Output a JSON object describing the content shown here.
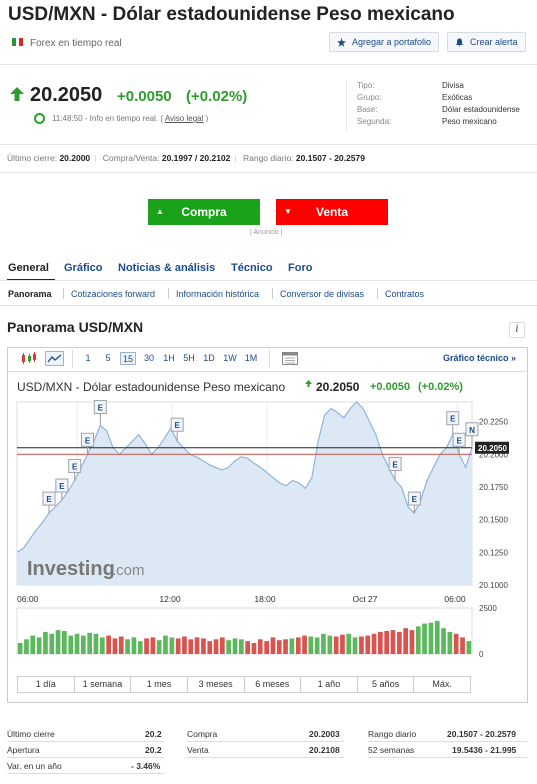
{
  "title": "USD/MXN - Dólar estadounidense Peso mexicano",
  "subtitle": "Forex en tiempo real",
  "buttons": {
    "portfolio": "Agregar a portafolio",
    "alert": "Crear alerta"
  },
  "price": {
    "last": "20.2050",
    "change": "+0.0050",
    "change_pct": "(+0.02%)"
  },
  "realtime": {
    "time": "11:48:50",
    "info": "- Info en tiempo real. (",
    "disclaimer": "Aviso legal",
    "close": ")"
  },
  "details": [
    {
      "label": "Tipo:",
      "value": "Divisa"
    },
    {
      "label": "Grupo:",
      "value": "Exóticas"
    },
    {
      "label": "Base:",
      "value": "Dólar estadounidense"
    },
    {
      "label": "Segunda:",
      "value": "Peso mexicano"
    }
  ],
  "stats": {
    "prev_close_label": "Último cierre:",
    "prev_close": "20.2000",
    "bidask_label": "Compra/Venta:",
    "bidask": "20.1997 / 20.2102",
    "range_label": "Rango diario:",
    "range": "20.1507 - 20.2579"
  },
  "cta": {
    "buy": "Compra",
    "sell": "Venta",
    "ad": "| Anuncio |"
  },
  "tabs": [
    "General",
    "Gráfico",
    "Noticias & análisis",
    "Técnico",
    "Foro"
  ],
  "subnav": [
    "Panorama",
    "Cotizaciones forward",
    "Información histórica",
    "Conversor de divisas",
    "Contratos"
  ],
  "section_title": "Panorama USD/MXN",
  "chart_toolbar": {
    "intervals": [
      "1",
      "5",
      "15",
      "30",
      "1H",
      "5H",
      "1D",
      "1W",
      "1M"
    ],
    "selected": "15",
    "technical_link": "Gráfico técnico »"
  },
  "chart_header": {
    "name": "USD/MXN - Dólar estadounidense Peso mexicano",
    "price": "20.2050",
    "change": "+0.0050",
    "change_pct": "(+0.02%)"
  },
  "watermark": {
    "brand": "Investing",
    "suffix": ".com"
  },
  "chart_data": {
    "type": "area",
    "x_labels": [
      "06:00",
      "12:00",
      "18:00",
      "Oct 27",
      "06:00"
    ],
    "y_ticks": [
      "20.2250",
      "20.2000",
      "20.1750",
      "20.1500",
      "20.1250",
      "20.1000"
    ],
    "ylim": [
      20.1,
      20.24
    ],
    "current_price_label": "20.2050",
    "previous_close": 20.2,
    "values": [
      20.125,
      20.128,
      20.135,
      20.142,
      20.148,
      20.155,
      20.16,
      20.165,
      20.172,
      20.18,
      20.19,
      20.2,
      20.21,
      20.222,
      20.218,
      20.205,
      20.2,
      20.205,
      20.21,
      20.215,
      20.208,
      20.2,
      20.205,
      20.212,
      20.22,
      20.21,
      20.205,
      20.2,
      20.198,
      20.195,
      20.192,
      20.19,
      20.188,
      20.19,
      20.195,
      20.198,
      20.197,
      20.193,
      20.19,
      20.186,
      20.182,
      20.178,
      20.176,
      20.18,
      20.178,
      20.174,
      20.182,
      20.21,
      20.23,
      20.235,
      20.232,
      20.228,
      20.235,
      20.24,
      20.235,
      20.225,
      20.215,
      20.2,
      20.19,
      20.18,
      20.175,
      20.16,
      20.155,
      20.165,
      20.18,
      20.19,
      20.2,
      20.205,
      20.215,
      20.2,
      20.19,
      20.205
    ],
    "event_markers": [
      "E",
      "E",
      "E",
      "E",
      "E",
      "E",
      "E",
      "E",
      "E",
      "E",
      "N"
    ],
    "volume_ticks": [
      "2500",
      "0"
    ],
    "volume": [
      600,
      800,
      1000,
      900,
      1200,
      1100,
      1300,
      1250,
      1000,
      1100,
      1000,
      1150,
      1100,
      900,
      1000,
      850,
      950,
      800,
      900,
      700,
      850,
      900,
      750,
      1000,
      900,
      850,
      950,
      800,
      900,
      850,
      700,
      800,
      900,
      750,
      850,
      800,
      700,
      600,
      800,
      700,
      900,
      750,
      800,
      850,
      900,
      1000,
      950,
      900,
      1100,
      1000,
      950,
      1050,
      1100,
      900,
      950,
      1000,
      1100,
      1200,
      1250,
      1300,
      1200,
      1400,
      1300,
      1500,
      1650,
      1700,
      1800,
      1400,
      1200,
      1100,
      900,
      700
    ]
  },
  "ranges": [
    "1 día",
    "1 semana",
    "1 mes",
    "3 meses",
    "6 meses",
    "1 año",
    "5 años",
    "Máx."
  ],
  "bottom_stats": {
    "col1": [
      {
        "label": "Último cierre",
        "value": "20.2"
      },
      {
        "label": "Apertura",
        "value": "20.2"
      },
      {
        "label": "Var. en un año",
        "value": "- 3.46%"
      }
    ],
    "col2": [
      {
        "label": "Compra",
        "value": "20.2003"
      },
      {
        "label": "Venta",
        "value": "20.2108"
      }
    ],
    "col3": [
      {
        "label": "Rango diario",
        "value": "20.1507 - 20.2579"
      },
      {
        "label": "52 semanas",
        "value": "19.5436 - 21.995"
      }
    ]
  },
  "colors": {
    "up": "#2e9c2e",
    "down": "#d93a3a",
    "link": "#1a4b8c",
    "buy": "#1aa31a",
    "sell": "#ff0000",
    "area": "#dce9f5",
    "line": "#8fb3da"
  }
}
